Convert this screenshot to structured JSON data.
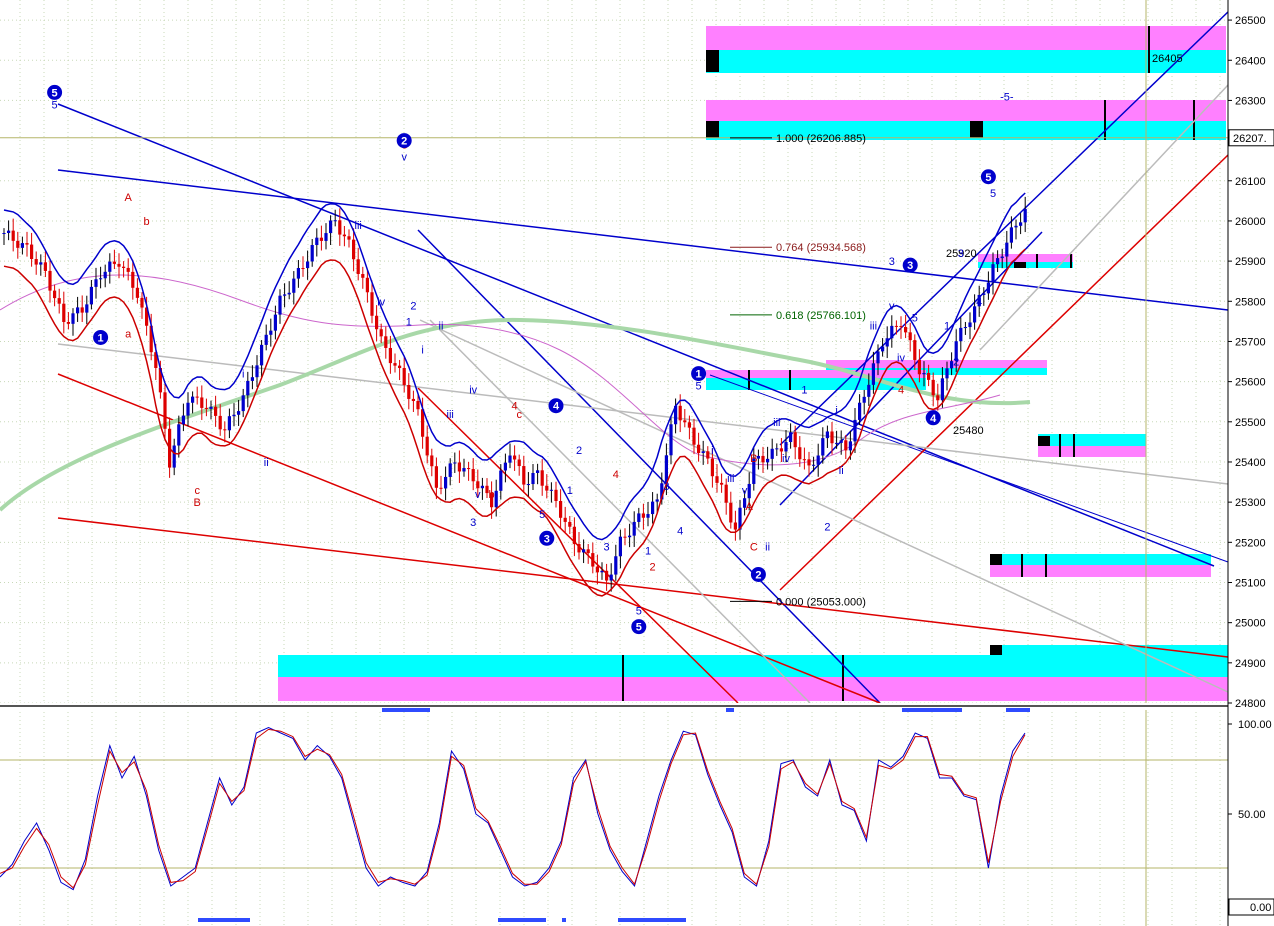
{
  "chart_data": [
    {
      "type": "candlestick",
      "panel": "price",
      "ylim": [
        24800,
        26550
      ],
      "y_ticks": [
        26500,
        26400,
        26300,
        26100,
        26000,
        25900,
        25800,
        25700,
        25600,
        25500,
        25400,
        25300,
        25200,
        25100,
        25000,
        24900,
        24800
      ],
      "y_tick_labels": [
        "26500",
        "26400",
        "26300",
        "26100",
        "26000",
        "25900",
        "25800",
        "25700",
        "25600",
        "25500",
        "25400",
        "25300",
        "25200",
        "25100",
        "25000",
        "24900",
        "24800"
      ],
      "current_price_label": "26207.",
      "current_price": 26207,
      "grid": true,
      "fib_levels": [
        {
          "label": "1.000 (26206.885)",
          "value": 26206.885,
          "color": "#000000"
        },
        {
          "label": "0.764 (25934.568)",
          "value": 25934.568,
          "color": "#8b1a1a"
        },
        {
          "label": "0.618 (25766.101)",
          "value": 25766.101,
          "color": "#006400"
        },
        {
          "label": "0.000 (25053.000)",
          "value": 25053.0,
          "color": "#000000"
        }
      ],
      "price_annotations": [
        {
          "text": "26405",
          "value": 26405
        },
        {
          "text": "25920",
          "value": 25920
        },
        {
          "text": "25480",
          "value": 25480
        }
      ],
      "close_series": [
        {
          "bar": 0,
          "close": 25970
        },
        {
          "bar": 5,
          "close": 25930
        },
        {
          "bar": 9,
          "close": 25870
        },
        {
          "bar": 13,
          "close": 25750
        },
        {
          "bar": 17,
          "close": 25780
        },
        {
          "bar": 21,
          "close": 25870
        },
        {
          "bar": 25,
          "close": 25900
        },
        {
          "bar": 29,
          "close": 25820
        },
        {
          "bar": 33,
          "close": 25640
        },
        {
          "bar": 36,
          "close": 25400
        },
        {
          "bar": 40,
          "close": 25560
        },
        {
          "bar": 44,
          "close": 25540
        },
        {
          "bar": 48,
          "close": 25480
        },
        {
          "bar": 52,
          "close": 25560
        },
        {
          "bar": 56,
          "close": 25680
        },
        {
          "bar": 60,
          "close": 25800
        },
        {
          "bar": 64,
          "close": 25870
        },
        {
          "bar": 68,
          "close": 25950
        },
        {
          "bar": 72,
          "close": 26000
        },
        {
          "bar": 75,
          "close": 25940
        },
        {
          "bar": 78,
          "close": 25850
        },
        {
          "bar": 82,
          "close": 25700
        },
        {
          "bar": 86,
          "close": 25620
        },
        {
          "bar": 90,
          "close": 25520
        },
        {
          "bar": 94,
          "close": 25330
        },
        {
          "bar": 98,
          "close": 25400
        },
        {
          "bar": 102,
          "close": 25360
        },
        {
          "bar": 106,
          "close": 25300
        },
        {
          "bar": 110,
          "close": 25430
        },
        {
          "bar": 113,
          "close": 25350
        },
        {
          "bar": 116,
          "close": 25370
        },
        {
          "bar": 120,
          "close": 25300
        },
        {
          "bar": 124,
          "close": 25200
        },
        {
          "bar": 128,
          "close": 25150
        },
        {
          "bar": 131,
          "close": 25100
        },
        {
          "bar": 134,
          "close": 25200
        },
        {
          "bar": 138,
          "close": 25260
        },
        {
          "bar": 142,
          "close": 25300
        },
        {
          "bar": 146,
          "close": 25540
        },
        {
          "bar": 150,
          "close": 25450
        },
        {
          "bar": 153,
          "close": 25400
        },
        {
          "bar": 156,
          "close": 25330
        },
        {
          "bar": 159,
          "close": 25230
        },
        {
          "bar": 163,
          "close": 25400
        },
        {
          "bar": 167,
          "close": 25420
        },
        {
          "bar": 171,
          "close": 25460
        },
        {
          "bar": 175,
          "close": 25380
        },
        {
          "bar": 179,
          "close": 25470
        },
        {
          "bar": 183,
          "close": 25430
        },
        {
          "bar": 187,
          "close": 25570
        },
        {
          "bar": 191,
          "close": 25700
        },
        {
          "bar": 195,
          "close": 25750
        },
        {
          "bar": 199,
          "close": 25630
        },
        {
          "bar": 203,
          "close": 25560
        },
        {
          "bar": 207,
          "close": 25700
        },
        {
          "bar": 211,
          "close": 25780
        },
        {
          "bar": 215,
          "close": 25880
        },
        {
          "bar": 219,
          "close": 25970
        },
        {
          "bar": 222,
          "close": 26030
        }
      ],
      "wave_labels": [
        {
          "text": "5",
          "bar": 11,
          "value": 26280,
          "color": "blue"
        },
        {
          "text": "A",
          "bar": 27,
          "value": 26050,
          "color": "red"
        },
        {
          "text": "b",
          "bar": 31,
          "value": 25990,
          "color": "red"
        },
        {
          "text": "a",
          "bar": 27,
          "value": 25710,
          "color": "red"
        },
        {
          "text": "c",
          "bar": 42,
          "value": 25320,
          "color": "red"
        },
        {
          "text": "B",
          "bar": 42,
          "value": 25290,
          "color": "red"
        },
        {
          "text": "i",
          "bar": 52,
          "value": 25610,
          "color": "blue"
        },
        {
          "text": "ii",
          "bar": 57,
          "value": 25390,
          "color": "blue"
        },
        {
          "text": "iii",
          "bar": 77,
          "value": 25980,
          "color": "blue"
        },
        {
          "text": "iv",
          "bar": 82,
          "value": 25790,
          "color": "blue"
        },
        {
          "text": "v",
          "bar": 87,
          "value": 26150,
          "color": "blue"
        },
        {
          "text": "C",
          "bar": 87,
          "value": 26180,
          "color": "red"
        },
        {
          "text": "2",
          "bar": 89,
          "value": 25780,
          "color": "blue"
        },
        {
          "text": "1",
          "bar": 88,
          "value": 25740,
          "color": "blue"
        },
        {
          "text": "i",
          "bar": 91,
          "value": 25670,
          "color": "blue"
        },
        {
          "text": "ii",
          "bar": 95,
          "value": 25730,
          "color": "blue"
        },
        {
          "text": "iii",
          "bar": 97,
          "value": 25510,
          "color": "blue"
        },
        {
          "text": "iv",
          "bar": 102,
          "value": 25570,
          "color": "blue"
        },
        {
          "text": "v",
          "bar": 103,
          "value": 25310,
          "color": "blue"
        },
        {
          "text": "b",
          "bar": 106,
          "value": 25310,
          "color": "red"
        },
        {
          "text": "4",
          "bar": 111,
          "value": 25530,
          "color": "red"
        },
        {
          "text": "c",
          "bar": 112,
          "value": 25510,
          "color": "red"
        },
        {
          "text": "3",
          "bar": 102,
          "value": 25240,
          "color": "blue"
        },
        {
          "text": "5",
          "bar": 117,
          "value": 25260,
          "color": "blue"
        },
        {
          "text": "1",
          "bar": 123,
          "value": 25320,
          "color": "blue"
        },
        {
          "text": "2",
          "bar": 125,
          "value": 25420,
          "color": "blue"
        },
        {
          "text": "4",
          "bar": 133,
          "value": 25360,
          "color": "red"
        },
        {
          "text": "3",
          "bar": 131,
          "value": 25180,
          "color": "blue"
        },
        {
          "text": "1",
          "bar": 140,
          "value": 25170,
          "color": "blue"
        },
        {
          "text": "2",
          "bar": 141,
          "value": 25130,
          "color": "red"
        },
        {
          "text": "5",
          "bar": 138,
          "value": 25020,
          "color": "blue"
        },
        {
          "text": "3",
          "bar": 144,
          "value": 25330,
          "color": "blue"
        },
        {
          "text": "4",
          "bar": 147,
          "value": 25220,
          "color": "blue"
        },
        {
          "text": "5",
          "bar": 151,
          "value": 25580,
          "color": "blue"
        },
        {
          "text": "i",
          "bar": 154,
          "value": 25420,
          "color": "blue"
        },
        {
          "text": "iii",
          "bar": 158,
          "value": 25350,
          "color": "blue"
        },
        {
          "text": "v",
          "bar": 161,
          "value": 25320,
          "color": "blue"
        },
        {
          "text": "B",
          "bar": 163,
          "value": 25400,
          "color": "red"
        },
        {
          "text": "A",
          "bar": 162,
          "value": 25280,
          "color": "red"
        },
        {
          "text": "C",
          "bar": 163,
          "value": 25180,
          "color": "red"
        },
        {
          "text": "ii",
          "bar": 166,
          "value": 25180,
          "color": "blue"
        },
        {
          "text": "iii",
          "bar": 168,
          "value": 25490,
          "color": "blue"
        },
        {
          "text": "iv",
          "bar": 170,
          "value": 25400,
          "color": "blue"
        },
        {
          "text": "1",
          "bar": 174,
          "value": 25570,
          "color": "blue"
        },
        {
          "text": "2",
          "bar": 179,
          "value": 25230,
          "color": "blue"
        },
        {
          "text": "i",
          "bar": 181,
          "value": 25520,
          "color": "blue"
        },
        {
          "text": "ii",
          "bar": 182,
          "value": 25370,
          "color": "blue"
        },
        {
          "text": "iii",
          "bar": 189,
          "value": 25730,
          "color": "blue"
        },
        {
          "text": "v",
          "bar": 193,
          "value": 25780,
          "color": "blue"
        },
        {
          "text": "3",
          "bar": 193,
          "value": 25890,
          "color": "blue"
        },
        {
          "text": "5",
          "bar": 198,
          "value": 25750,
          "color": "blue"
        },
        {
          "text": "iv",
          "bar": 195,
          "value": 25650,
          "color": "blue"
        },
        {
          "text": "4",
          "bar": 195,
          "value": 25570,
          "color": "red"
        },
        {
          "text": "1",
          "bar": 205,
          "value": 25730,
          "color": "blue"
        },
        {
          "text": "2",
          "bar": 207,
          "value": 25640,
          "color": "blue"
        },
        {
          "text": "3",
          "bar": 208,
          "value": 25910,
          "color": "blue"
        },
        {
          "text": "4",
          "bar": 212,
          "value": 25790,
          "color": "blue"
        },
        {
          "text": "5",
          "bar": 215,
          "value": 26060,
          "color": "blue"
        },
        {
          "text": "-5-",
          "bar": 218,
          "value": 26300,
          "color": "blue"
        }
      ],
      "circled_waves": [
        {
          "text": "5",
          "bar": 11,
          "value": 26320
        },
        {
          "text": "1",
          "bar": 21,
          "value": 25710
        },
        {
          "text": "2",
          "bar": 87,
          "value": 26200
        },
        {
          "text": "3",
          "bar": 118,
          "value": 25210
        },
        {
          "text": "4",
          "bar": 120,
          "value": 25540
        },
        {
          "text": "5",
          "bar": 138,
          "value": 24990
        },
        {
          "text": "1",
          "bar": 151,
          "value": 25620
        },
        {
          "text": "2",
          "bar": 164,
          "value": 25120
        },
        {
          "text": "3",
          "bar": 197,
          "value": 25890
        },
        {
          "text": "4",
          "bar": 202,
          "value": 25510
        },
        {
          "text": "5",
          "bar": 214,
          "value": 26110
        }
      ]
    },
    {
      "type": "line",
      "panel": "oscillator",
      "ylim": [
        0,
        100
      ],
      "y_ticks": [
        100,
        50,
        0
      ],
      "y_tick_labels": [
        "100.00",
        "50.00",
        "0.00"
      ],
      "levels": [
        80,
        20
      ],
      "series": [
        {
          "color": "#0000cc",
          "values": [
            15,
            22,
            35,
            45,
            30,
            12,
            8,
            25,
            60,
            88,
            70,
            82,
            60,
            30,
            10,
            15,
            20,
            45,
            70,
            55,
            65,
            95,
            98,
            95,
            92,
            80,
            88,
            82,
            70,
            45,
            20,
            10,
            15,
            12,
            10,
            18,
            45,
            85,
            75,
            50,
            45,
            30,
            15,
            10,
            12,
            20,
            35,
            70,
            80,
            50,
            30,
            18,
            10,
            35,
            60,
            80,
            96,
            94,
            72,
            55,
            40,
            15,
            10,
            35,
            78,
            80,
            65,
            60,
            80,
            55,
            52,
            35,
            80,
            76,
            82,
            95,
            92,
            70,
            70,
            60,
            58,
            20,
            60,
            85,
            95
          ]
        },
        {
          "color": "#cc0000",
          "values": [
            17,
            20,
            32,
            42,
            33,
            15,
            9,
            22,
            55,
            85,
            73,
            79,
            63,
            33,
            12,
            13,
            18,
            42,
            67,
            57,
            63,
            92,
            97,
            96,
            93,
            82,
            86,
            83,
            72,
            48,
            23,
            12,
            14,
            13,
            11,
            16,
            42,
            82,
            77,
            53,
            46,
            32,
            17,
            11,
            11,
            18,
            33,
            67,
            79,
            53,
            32,
            20,
            11,
            32,
            57,
            78,
            94,
            95,
            74,
            57,
            42,
            17,
            11,
            32,
            75,
            79,
            67,
            61,
            78,
            57,
            53,
            37,
            77,
            75,
            80,
            93,
            93,
            72,
            71,
            61,
            59,
            23,
            57,
            82,
            94
          ]
        }
      ]
    }
  ]
}
